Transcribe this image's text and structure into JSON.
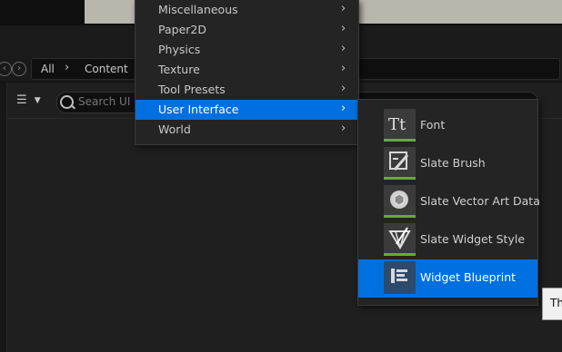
{
  "breadcrumb": {
    "root": "All",
    "separator": "›",
    "folder": "Content"
  },
  "search": {
    "placeholder": "Search UI"
  },
  "menu": {
    "items": [
      {
        "label": "Miscellaneous"
      },
      {
        "label": "Paper2D"
      },
      {
        "label": "Physics"
      },
      {
        "label": "Texture"
      },
      {
        "label": "Tool Presets"
      },
      {
        "label": "User Interface",
        "active": true
      },
      {
        "label": "World"
      }
    ]
  },
  "submenu": {
    "items": [
      {
        "label": "Font",
        "icon": "font-icon"
      },
      {
        "label": "Slate Brush",
        "icon": "slate-brush-icon"
      },
      {
        "label": "Slate Vector Art Data",
        "icon": "vector-art-icon"
      },
      {
        "label": "Slate Widget Style",
        "icon": "widget-style-icon"
      },
      {
        "label": "Widget Blueprint",
        "icon": "widget-blueprint-icon",
        "active": true
      }
    ]
  },
  "tooltip": {
    "text": "Th"
  },
  "colors": {
    "accent": "#0070e0",
    "asset_bar": "#6aab2e"
  }
}
